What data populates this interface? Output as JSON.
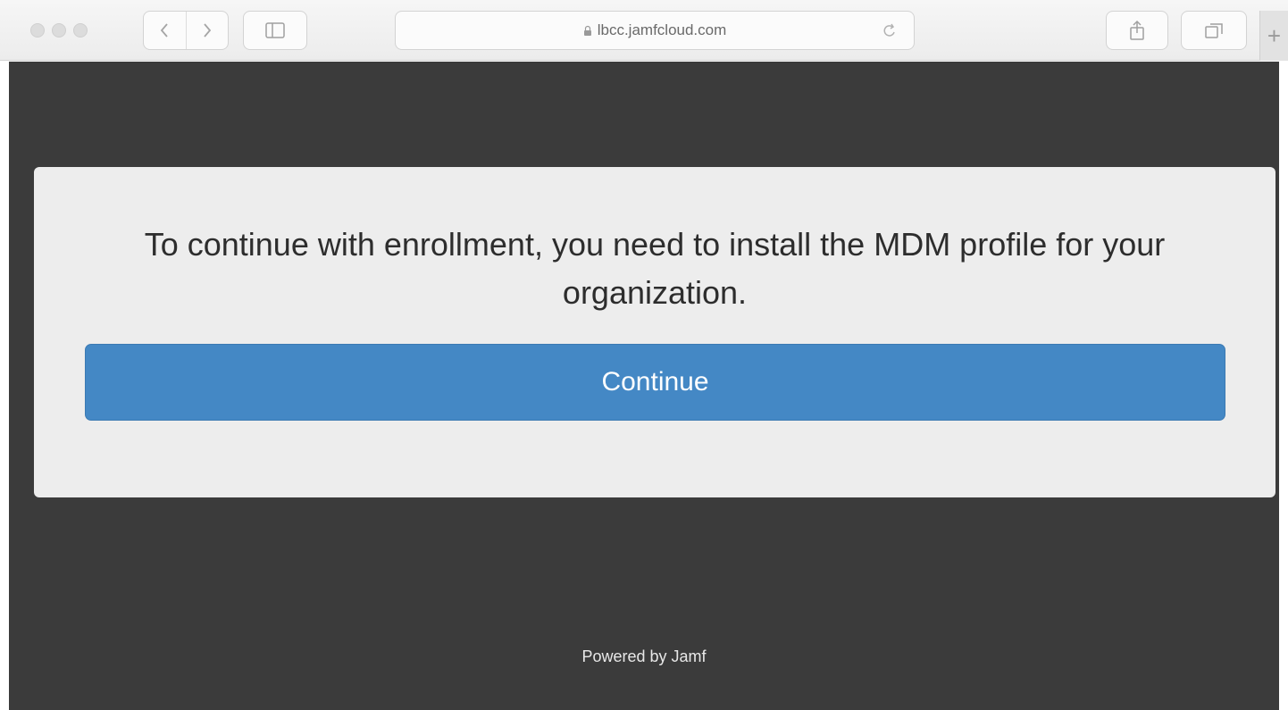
{
  "browser": {
    "address_bar": {
      "url": "lbcc.jamfcloud.com",
      "secure_icon": "lock-icon",
      "reload_icon": "reload-icon"
    },
    "toolbar_icons": {
      "back": "chevron-left-icon",
      "forward": "chevron-right-icon",
      "sidebar": "sidebar-icon",
      "share": "share-icon",
      "tabs": "tabs-overview-icon",
      "new_tab": "plus-icon"
    },
    "new_tab_label": "+"
  },
  "enrollment": {
    "message": "To continue with enrollment, you need to install the MDM profile for your organization.",
    "continue_label": "Continue"
  },
  "footer": {
    "text": "Powered by Jamf"
  },
  "colors": {
    "page_background": "#3b3b3b",
    "card_background": "#ededed",
    "button_background": "#4488c5",
    "button_text": "#ffffff"
  }
}
